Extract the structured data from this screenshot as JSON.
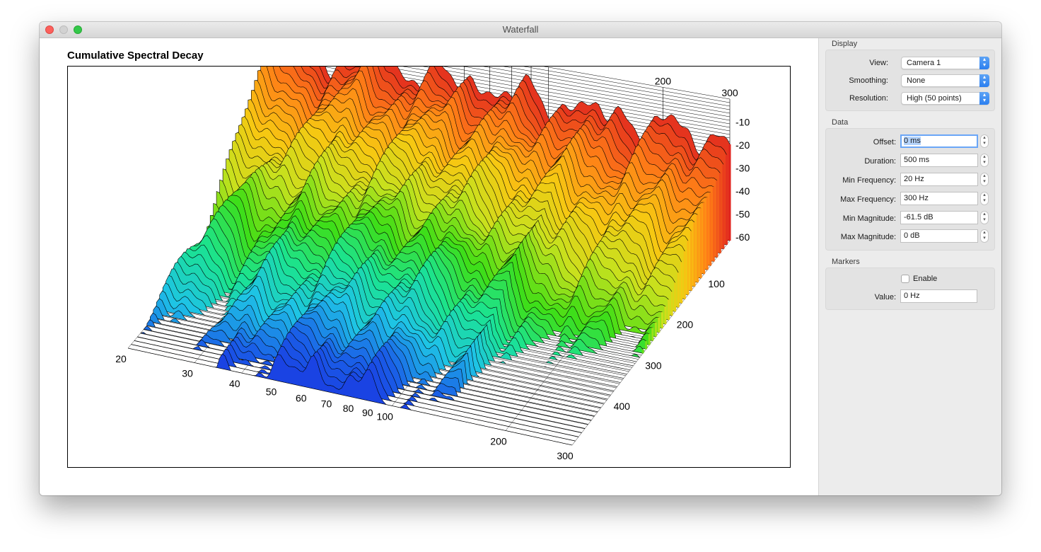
{
  "window": {
    "title": "Waterfall"
  },
  "chart": {
    "title": "Cumulative Spectral Decay"
  },
  "chart_data": {
    "type": "waterfall-3d",
    "title": "Cumulative Spectral Decay",
    "x_axis": {
      "scale": "log",
      "range": [
        20,
        300
      ],
      "tick_labels": [
        "20",
        "30",
        "40",
        "50",
        "60",
        "70",
        "80",
        "90",
        "100",
        "200",
        "300"
      ]
    },
    "time_axis": {
      "range": [
        0,
        500
      ],
      "tick_labels": [
        "100",
        "200",
        "300",
        "400"
      ]
    },
    "z_axis": {
      "range": [
        -61.5,
        0
      ],
      "tick_labels": [
        "-10",
        "-20",
        "-30",
        "-40",
        "-50",
        "-60"
      ]
    },
    "slices": 50,
    "colormap": [
      "#e0241f",
      "#ff7f17",
      "#f7c712",
      "#c7e11e",
      "#3fde16",
      "#1be392",
      "#1ec3e6",
      "#1a5fe7",
      "#1a2ee0"
    ]
  },
  "sidebar": {
    "display": {
      "label": "Display",
      "view_label": "View:",
      "view_value": "Camera 1",
      "smoothing_label": "Smoothing:",
      "smoothing_value": "None",
      "resolution_label": "Resolution:",
      "resolution_value": "High (50 points)"
    },
    "data": {
      "label": "Data",
      "offset_label": "Offset:",
      "offset_value": "0 ms",
      "duration_label": "Duration:",
      "duration_value": "500 ms",
      "minfreq_label": "Min Frequency:",
      "minfreq_value": "20 Hz",
      "maxfreq_label": "Max Frequency:",
      "maxfreq_value": "300 Hz",
      "minmag_label": "Min Magnitude:",
      "minmag_value": "-61.5 dB",
      "maxmag_label": "Max Magnitude:",
      "maxmag_value": "0 dB"
    },
    "markers": {
      "label": "Markers",
      "enable_label": "Enable",
      "enable_checked": false,
      "value_label": "Value:",
      "value_value": "0 Hz"
    }
  }
}
